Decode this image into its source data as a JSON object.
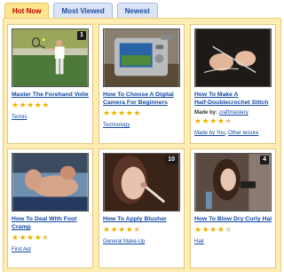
{
  "tabs": [
    "Hot Now",
    "Most Viewed",
    "Newest"
  ],
  "colors": {
    "accent": "#c00000",
    "link": "#1048a6",
    "panel": "#ffedb4",
    "star": "#f0b400"
  },
  "cards": [
    {
      "title": [
        "Master The Forehand Volley"
      ],
      "badge": "1",
      "rating": 5,
      "category": "Tennis",
      "thumb": "tennis-player"
    },
    {
      "title": [
        "How To Choose A Digital",
        "Camera For Beginners"
      ],
      "badge": "",
      "rating": 5,
      "category": "Technology",
      "thumb": "digital-camera"
    },
    {
      "title": [
        "How To Make A",
        "Half-Doublecrochet Stitch"
      ],
      "badge": "",
      "rating": 4.5,
      "made_by_label": "Made by:",
      "made_by": "craftmastery",
      "categories": [
        "Made by You",
        "Other leisure"
      ],
      "thumb": "crochet-hands"
    },
    {
      "title": [
        "How To Deal With Foot",
        "Cramp"
      ],
      "badge": "",
      "rating": 4.5,
      "category": "First Aid",
      "thumb": "foot"
    },
    {
      "title": [
        "How To Apply Blusher"
      ],
      "badge": "10",
      "rating": 4.5,
      "category": "General Make-Up",
      "thumb": "makeup-woman"
    },
    {
      "title": [
        "How To Blow Dry Curly Hair"
      ],
      "badge": "4",
      "rating": 4,
      "category": "Hair",
      "thumb": "hair-dryer"
    }
  ]
}
